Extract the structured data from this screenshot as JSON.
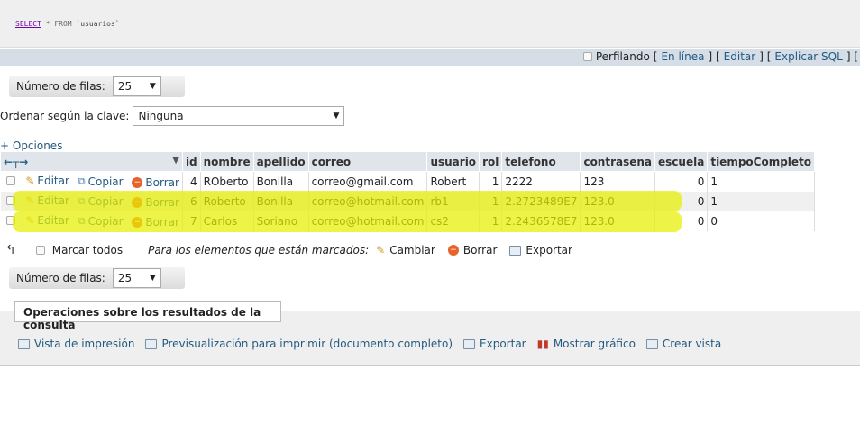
{
  "sql": {
    "keyword": "SELECT",
    "rest": " * FROM ",
    "table": "`usuarios`"
  },
  "profiling": {
    "label": "Perfilando",
    "links": [
      "En línea",
      "Editar",
      "Explicar SQL"
    ]
  },
  "rows_control": {
    "label": "Número de filas:",
    "value": "25"
  },
  "sort": {
    "label": "Ordenar según la clave:",
    "value": "Ninguna"
  },
  "options_label": "+ Opciones",
  "columns": [
    "id",
    "nombre",
    "apellido",
    "correo",
    "usuario",
    "rol",
    "telefono",
    "contrasena",
    "escuela",
    "tiempoCompleto"
  ],
  "row_actions": {
    "edit": "Editar",
    "copy": "Copiar",
    "delete": "Borrar"
  },
  "rows": [
    {
      "id": "4",
      "nombre": "ROberto",
      "apellido": "Bonilla",
      "correo": "correo@gmail.com",
      "usuario": "Robert",
      "rol": "1",
      "telefono": "2222",
      "contrasena": "123",
      "escuela": "0",
      "tiempoCompleto": "1"
    },
    {
      "id": "6",
      "nombre": "Roberto",
      "apellido": "Bonilla",
      "correo": "correo@hotmail.com",
      "usuario": "rb1",
      "rol": "1",
      "telefono": "2.2723489E7",
      "contrasena": "123.0",
      "escuela": "0",
      "tiempoCompleto": "1"
    },
    {
      "id": "7",
      "nombre": "Carlos",
      "apellido": "Soriano",
      "correo": "correo@hotmail.com",
      "usuario": "cs2",
      "rol": "1",
      "telefono": "2.2436578E7",
      "contrasena": "123.0",
      "escuela": "0",
      "tiempoCompleto": "0"
    }
  ],
  "bulk": {
    "check_all": "Marcar todos",
    "with_selected": "Para los elementos que están marcados:",
    "change": "Cambiar",
    "delete": "Borrar",
    "export": "Exportar"
  },
  "ops": {
    "title": "Operaciones sobre los resultados de la consulta",
    "links": [
      "Vista de impresión",
      "Previsualización para imprimir (documento completo)",
      "Exportar",
      "Mostrar gráfico",
      "Crear vista"
    ]
  },
  "colors": {
    "highlight": "#e8f000",
    "link": "#235a81",
    "header_bg": "#dfe5eb"
  }
}
